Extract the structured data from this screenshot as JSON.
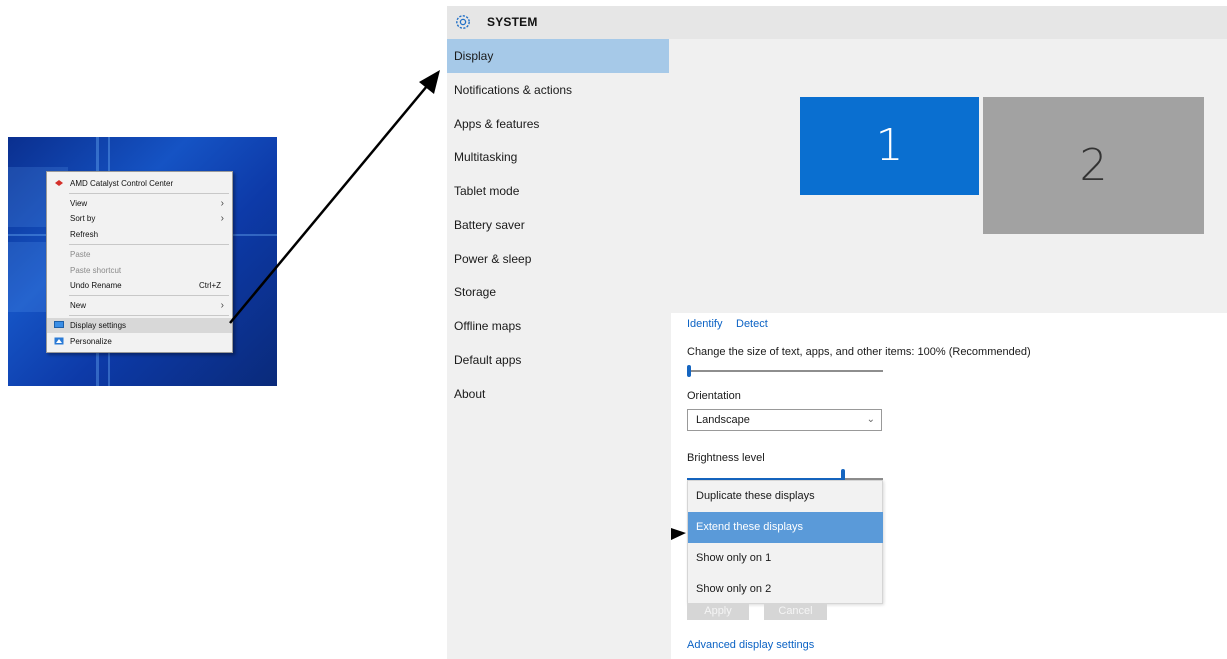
{
  "context_menu": {
    "items": [
      {
        "label": "AMD Catalyst Control Center",
        "icon": "amd-icon"
      },
      {
        "label": "View",
        "submenu": true
      },
      {
        "label": "Sort by",
        "submenu": true
      },
      {
        "label": "Refresh"
      },
      {
        "label": "Paste",
        "disabled": true
      },
      {
        "label": "Paste shortcut",
        "disabled": true
      },
      {
        "label": "Undo Rename",
        "shortcut": "Ctrl+Z"
      },
      {
        "label": "New",
        "submenu": true
      },
      {
        "label": "Display settings",
        "icon": "display-icon",
        "highlighted": true
      },
      {
        "label": "Personalize",
        "icon": "personalize-icon"
      }
    ],
    "submenu_glyph": "›"
  },
  "window": {
    "title": "SYSTEM",
    "icon": "gear-icon"
  },
  "sidebar": {
    "items": [
      {
        "label": "Display",
        "active": true
      },
      {
        "label": "Notifications & actions"
      },
      {
        "label": "Apps & features"
      },
      {
        "label": "Multitasking"
      },
      {
        "label": "Tablet mode"
      },
      {
        "label": "Battery saver"
      },
      {
        "label": "Power & sleep"
      },
      {
        "label": "Storage"
      },
      {
        "label": "Offline maps"
      },
      {
        "label": "Default apps"
      },
      {
        "label": "About"
      }
    ]
  },
  "display": {
    "monitors": [
      {
        "label": "1",
        "color": "#0a6fd0"
      },
      {
        "label": "2",
        "color": "#a2a2a2"
      }
    ],
    "identify_label": "Identify",
    "detect_label": "Detect",
    "scale_label": "Change the size of text, apps, and other items: 100% (Recommended)",
    "scale_value": 0,
    "orientation_label": "Orientation",
    "orientation_value": "Landscape",
    "brightness_label": "Brightness level",
    "brightness_value": 0.8,
    "multiple_displays_options": [
      {
        "label": "Duplicate these displays"
      },
      {
        "label": "Extend these displays",
        "selected": true
      },
      {
        "label": "Show only on 1"
      },
      {
        "label": "Show only on 2"
      }
    ],
    "apply_label": "Apply",
    "cancel_label": "Cancel",
    "advanced_link": "Advanced display settings"
  },
  "colors": {
    "accent": "#0a6fd0",
    "sidebar_selected": "#a6c9e8",
    "dropdown_selected": "#5a9ad9",
    "link": "#0b62c4"
  }
}
